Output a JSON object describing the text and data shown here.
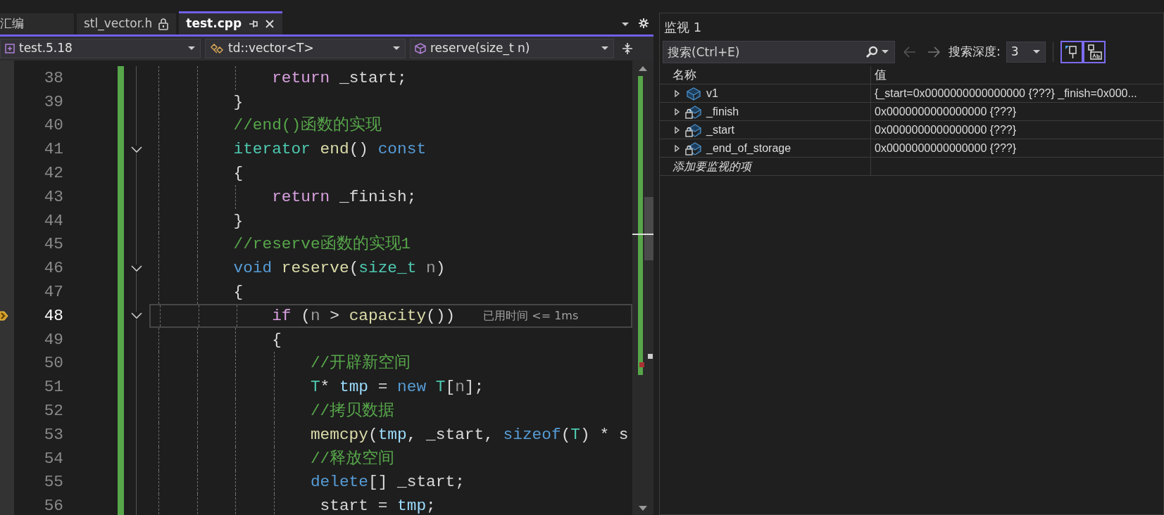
{
  "editor": {
    "tabs": [
      {
        "label": "汇编",
        "selected": false,
        "locked": false
      },
      {
        "label": "stl_vector.h",
        "selected": false,
        "locked": true
      },
      {
        "label": "test.cpp",
        "selected": true,
        "locked": false
      }
    ],
    "nav": {
      "project": "test.5.18",
      "scope": "td::vector<T>",
      "member": "reserve(size_t n)"
    },
    "lines": [
      {
        "number": "38",
        "foldable": false,
        "current": false,
        "tokens": [
          {
            "kind": "control",
            "text": "            return"
          },
          {
            "kind": "field",
            "text": " _start"
          },
          {
            "kind": "punct",
            "text": ";"
          }
        ]
      },
      {
        "number": "39",
        "foldable": false,
        "current": false,
        "tokens": [
          {
            "kind": "punct",
            "text": "        }"
          }
        ]
      },
      {
        "number": "40",
        "foldable": false,
        "current": false,
        "tokens": [
          {
            "kind": "comment",
            "text": "        //end()函数的实现"
          }
        ]
      },
      {
        "number": "41",
        "foldable": true,
        "current": false,
        "tokens": [
          {
            "kind": "type",
            "text": "        iterator"
          },
          {
            "kind": "func",
            "text": " end"
          },
          {
            "kind": "punct",
            "text": "() "
          },
          {
            "kind": "keyword",
            "text": "const"
          }
        ]
      },
      {
        "number": "42",
        "foldable": false,
        "current": false,
        "tokens": [
          {
            "kind": "punct",
            "text": "        {"
          }
        ]
      },
      {
        "number": "43",
        "foldable": false,
        "current": false,
        "tokens": [
          {
            "kind": "control",
            "text": "            return"
          },
          {
            "kind": "field",
            "text": " _finish"
          },
          {
            "kind": "punct",
            "text": ";"
          }
        ]
      },
      {
        "number": "44",
        "foldable": false,
        "current": false,
        "tokens": [
          {
            "kind": "punct",
            "text": "        }"
          }
        ]
      },
      {
        "number": "45",
        "foldable": false,
        "current": false,
        "tokens": [
          {
            "kind": "comment",
            "text": "        //reserve函数的实现1"
          }
        ]
      },
      {
        "number": "46",
        "foldable": true,
        "current": false,
        "tokens": [
          {
            "kind": "keyword",
            "text": "        void"
          },
          {
            "kind": "func",
            "text": " reserve"
          },
          {
            "kind": "punct",
            "text": "("
          },
          {
            "kind": "type",
            "text": "size_t"
          },
          {
            "kind": "param",
            "text": " n"
          },
          {
            "kind": "punct",
            "text": ")"
          }
        ]
      },
      {
        "number": "47",
        "foldable": false,
        "current": false,
        "tokens": [
          {
            "kind": "punct",
            "text": "        {"
          }
        ]
      },
      {
        "number": "48",
        "foldable": true,
        "current": true,
        "hint": "已用时间 <= 1ms",
        "tokens": [
          {
            "kind": "control",
            "text": "            if"
          },
          {
            "kind": "punct",
            "text": " ("
          },
          {
            "kind": "param",
            "text": "n"
          },
          {
            "kind": "punct",
            "text": " > "
          },
          {
            "kind": "func",
            "text": "capacity"
          },
          {
            "kind": "punct",
            "text": "())"
          }
        ]
      },
      {
        "number": "49",
        "foldable": false,
        "current": false,
        "tokens": [
          {
            "kind": "punct",
            "text": "            {"
          }
        ]
      },
      {
        "number": "50",
        "foldable": false,
        "current": false,
        "tokens": [
          {
            "kind": "comment",
            "text": "                //开辟新空间"
          }
        ]
      },
      {
        "number": "51",
        "foldable": false,
        "current": false,
        "tokens": [
          {
            "kind": "type",
            "text": "                T"
          },
          {
            "kind": "punct",
            "text": "*"
          },
          {
            "kind": "local",
            "text": " tmp"
          },
          {
            "kind": "punct",
            "text": " = "
          },
          {
            "kind": "keyword",
            "text": "new"
          },
          {
            "kind": "type",
            "text": " T"
          },
          {
            "kind": "punct",
            "text": "["
          },
          {
            "kind": "param",
            "text": "n"
          },
          {
            "kind": "punct",
            "text": "];"
          }
        ]
      },
      {
        "number": "52",
        "foldable": false,
        "current": false,
        "tokens": [
          {
            "kind": "comment",
            "text": "                //拷贝数据"
          }
        ]
      },
      {
        "number": "53",
        "foldable": false,
        "current": false,
        "tokens": [
          {
            "kind": "func",
            "text": "                memcpy"
          },
          {
            "kind": "punct",
            "text": "("
          },
          {
            "kind": "local",
            "text": "tmp"
          },
          {
            "kind": "punct",
            "text": ", "
          },
          {
            "kind": "field",
            "text": "_start"
          },
          {
            "kind": "punct",
            "text": ", "
          },
          {
            "kind": "keyword",
            "text": "sizeof"
          },
          {
            "kind": "punct",
            "text": "("
          },
          {
            "kind": "type",
            "text": "T"
          },
          {
            "kind": "punct",
            "text": ") * s"
          }
        ]
      },
      {
        "number": "54",
        "foldable": false,
        "current": false,
        "tokens": [
          {
            "kind": "comment",
            "text": "                //释放空间"
          }
        ]
      },
      {
        "number": "55",
        "foldable": false,
        "current": false,
        "tokens": [
          {
            "kind": "keyword",
            "text": "                delete"
          },
          {
            "kind": "punct",
            "text": "[] "
          },
          {
            "kind": "field",
            "text": "_start"
          },
          {
            "kind": "punct",
            "text": ";"
          }
        ]
      },
      {
        "number": "56",
        "foldable": false,
        "current": false,
        "tokens": [
          {
            "kind": "field",
            "text": "                 start"
          },
          {
            "kind": "punct",
            "text": " = "
          },
          {
            "kind": "local",
            "text": "tmp"
          },
          {
            "kind": "punct",
            "text": ";"
          }
        ]
      }
    ]
  },
  "watch": {
    "title": "监视 1",
    "search": {
      "placeholder": "搜索(Ctrl+E)"
    },
    "nav_buttons": [
      {
        "kind": "back",
        "disabled": true
      },
      {
        "kind": "forward",
        "disabled": false
      }
    ],
    "depth_label": "搜索深度:",
    "depth": "3",
    "toggles": [
      {
        "kind": "pin",
        "selected": true
      },
      {
        "kind": "pin-text",
        "selected": true
      }
    ],
    "columns": [
      "名称",
      "值"
    ],
    "rows": [
      {
        "kind": "object",
        "name": "v1",
        "value": "{_start=0x0000000000000000 {???} _finish=0x000...",
        "expanded": false
      },
      {
        "kind": "private",
        "name": "_finish",
        "value": "0x0000000000000000 {???}",
        "expanded": false
      },
      {
        "kind": "private",
        "name": "_start",
        "value": "0x0000000000000000 {???}",
        "expanded": false
      },
      {
        "kind": "private",
        "name": "_end_of_storage",
        "value": "0x0000000000000000 {???}",
        "expanded": false
      }
    ],
    "add_item": "添加要监视的项"
  }
}
